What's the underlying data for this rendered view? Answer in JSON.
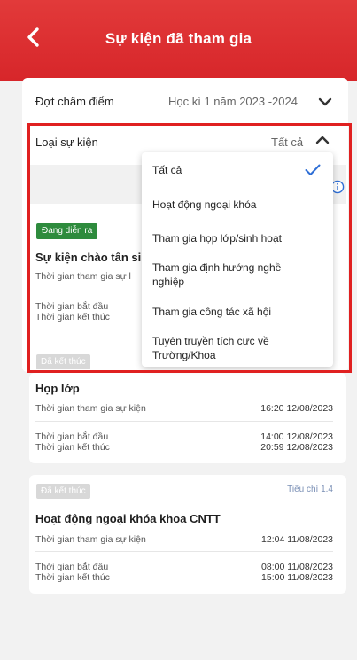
{
  "header": {
    "title": "Sự kiện đã tham gia"
  },
  "filters": {
    "period_label": "Đợt chấm điểm",
    "period_value": "Học kì 1 năm 2023 -2024",
    "type_label": "Loại sự kiện",
    "type_value": "Tất cả"
  },
  "dropdown": {
    "options": [
      "Tất cả",
      "Hoạt động ngoại khóa",
      "Tham gia họp lớp/sinh hoạt",
      "Tham gia định hướng nghề nghiệp",
      "Tham gia công tác xã hội",
      "Tuyên truyền tích cực về Trường/Khoa"
    ],
    "selected": "Tất cả"
  },
  "events": [
    {
      "status": "Đang diễn ra",
      "title": "Sự kiện chào tân si",
      "join_label": "Thời gian tham gia sự l",
      "start_label": "Thời gian bắt đầu",
      "end_label": "Thời gian kết thúc"
    },
    {
      "status": "Đã kết thúc",
      "title": "Họp lớp",
      "join_label": "Thời gian tham gia sự kiện",
      "join_time": "16:20 12/08/2023",
      "start_label": "Thời gian bắt đầu",
      "start_time": "14:00 12/08/2023",
      "end_label": "Thời gian kết thúc",
      "end_time": "20:59 12/08/2023"
    },
    {
      "status": "Đã kết thúc",
      "criteria": "Tiêu chí 1.4",
      "title": "Hoạt động ngoại khóa khoa CNTT",
      "join_label": "Thời gian tham gia sự kiện",
      "join_time": "12:04 11/08/2023",
      "start_label": "Thời gian bắt đầu",
      "start_time": "08:00 11/08/2023",
      "end_label": "Thời gian kết thúc",
      "end_time": "15:00 11/08/2023"
    }
  ],
  "colors": {
    "brand": "#d7262a",
    "live": "#2e8b3d",
    "check": "#2f6fd6",
    "highlight": "#e02020"
  }
}
